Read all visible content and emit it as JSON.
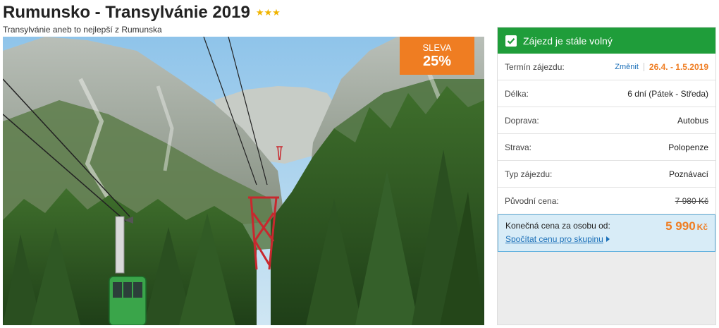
{
  "header": {
    "title": "Rumunsko - Transylvánie 2019",
    "stars": "★★★",
    "subtitle": "Transylvánie aneb to nejlepší z Rumunska"
  },
  "photo": {
    "discount_label": "SLEVA",
    "discount_value": "25%"
  },
  "panel": {
    "availability": "Zájezd je stále volný",
    "rows": [
      {
        "label": "Termín zájezdu:",
        "change": "Změnit",
        "value": "26.4. - 1.5.2019"
      },
      {
        "label": "Délka:",
        "value": "6 dní (Pátek - Středa)"
      },
      {
        "label": "Doprava:",
        "value": "Autobus"
      },
      {
        "label": "Strava:",
        "value": "Polopenze"
      },
      {
        "label": "Typ zájezdu:",
        "value": "Poznávací"
      },
      {
        "label": "Původní cena:",
        "value": "7 980 Kč"
      }
    ],
    "final": {
      "label": "Konečná cena za osobu od:",
      "price": "5 990",
      "currency": "Kč",
      "group_link": "Spočítat cenu pro skupinu"
    }
  },
  "colors": {
    "accent_orange": "#ef7d22",
    "available_green": "#1f9d3a",
    "link_blue": "#1a6fb8",
    "star_gold": "#f0b400"
  }
}
